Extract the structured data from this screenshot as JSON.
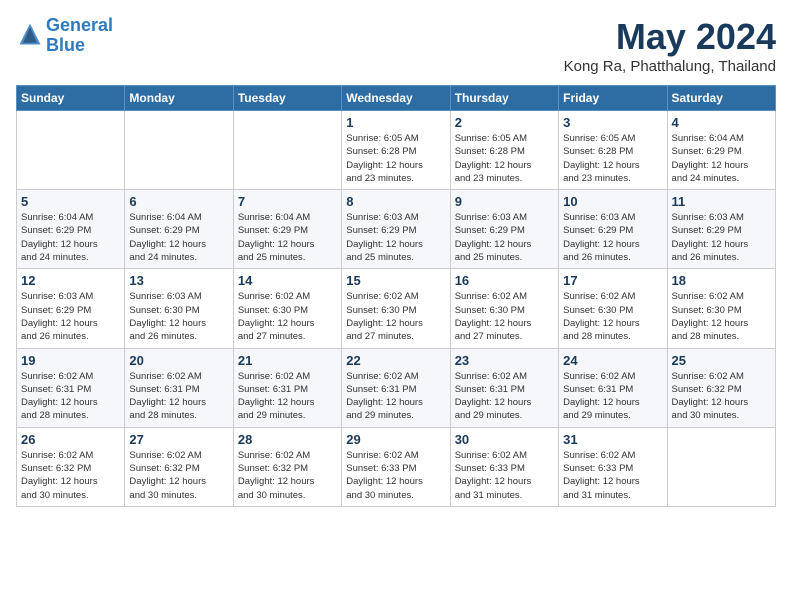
{
  "logo": {
    "line1": "General",
    "line2": "Blue"
  },
  "title": "May 2024",
  "location": "Kong Ra, Phatthalung, Thailand",
  "weekdays": [
    "Sunday",
    "Monday",
    "Tuesday",
    "Wednesday",
    "Thursday",
    "Friday",
    "Saturday"
  ],
  "weeks": [
    [
      {
        "day": "",
        "info": ""
      },
      {
        "day": "",
        "info": ""
      },
      {
        "day": "",
        "info": ""
      },
      {
        "day": "1",
        "info": "Sunrise: 6:05 AM\nSunset: 6:28 PM\nDaylight: 12 hours\nand 23 minutes."
      },
      {
        "day": "2",
        "info": "Sunrise: 6:05 AM\nSunset: 6:28 PM\nDaylight: 12 hours\nand 23 minutes."
      },
      {
        "day": "3",
        "info": "Sunrise: 6:05 AM\nSunset: 6:28 PM\nDaylight: 12 hours\nand 23 minutes."
      },
      {
        "day": "4",
        "info": "Sunrise: 6:04 AM\nSunset: 6:29 PM\nDaylight: 12 hours\nand 24 minutes."
      }
    ],
    [
      {
        "day": "5",
        "info": "Sunrise: 6:04 AM\nSunset: 6:29 PM\nDaylight: 12 hours\nand 24 minutes."
      },
      {
        "day": "6",
        "info": "Sunrise: 6:04 AM\nSunset: 6:29 PM\nDaylight: 12 hours\nand 24 minutes."
      },
      {
        "day": "7",
        "info": "Sunrise: 6:04 AM\nSunset: 6:29 PM\nDaylight: 12 hours\nand 25 minutes."
      },
      {
        "day": "8",
        "info": "Sunrise: 6:03 AM\nSunset: 6:29 PM\nDaylight: 12 hours\nand 25 minutes."
      },
      {
        "day": "9",
        "info": "Sunrise: 6:03 AM\nSunset: 6:29 PM\nDaylight: 12 hours\nand 25 minutes."
      },
      {
        "day": "10",
        "info": "Sunrise: 6:03 AM\nSunset: 6:29 PM\nDaylight: 12 hours\nand 26 minutes."
      },
      {
        "day": "11",
        "info": "Sunrise: 6:03 AM\nSunset: 6:29 PM\nDaylight: 12 hours\nand 26 minutes."
      }
    ],
    [
      {
        "day": "12",
        "info": "Sunrise: 6:03 AM\nSunset: 6:29 PM\nDaylight: 12 hours\nand 26 minutes."
      },
      {
        "day": "13",
        "info": "Sunrise: 6:03 AM\nSunset: 6:30 PM\nDaylight: 12 hours\nand 26 minutes."
      },
      {
        "day": "14",
        "info": "Sunrise: 6:02 AM\nSunset: 6:30 PM\nDaylight: 12 hours\nand 27 minutes."
      },
      {
        "day": "15",
        "info": "Sunrise: 6:02 AM\nSunset: 6:30 PM\nDaylight: 12 hours\nand 27 minutes."
      },
      {
        "day": "16",
        "info": "Sunrise: 6:02 AM\nSunset: 6:30 PM\nDaylight: 12 hours\nand 27 minutes."
      },
      {
        "day": "17",
        "info": "Sunrise: 6:02 AM\nSunset: 6:30 PM\nDaylight: 12 hours\nand 28 minutes."
      },
      {
        "day": "18",
        "info": "Sunrise: 6:02 AM\nSunset: 6:30 PM\nDaylight: 12 hours\nand 28 minutes."
      }
    ],
    [
      {
        "day": "19",
        "info": "Sunrise: 6:02 AM\nSunset: 6:31 PM\nDaylight: 12 hours\nand 28 minutes."
      },
      {
        "day": "20",
        "info": "Sunrise: 6:02 AM\nSunset: 6:31 PM\nDaylight: 12 hours\nand 28 minutes."
      },
      {
        "day": "21",
        "info": "Sunrise: 6:02 AM\nSunset: 6:31 PM\nDaylight: 12 hours\nand 29 minutes."
      },
      {
        "day": "22",
        "info": "Sunrise: 6:02 AM\nSunset: 6:31 PM\nDaylight: 12 hours\nand 29 minutes."
      },
      {
        "day": "23",
        "info": "Sunrise: 6:02 AM\nSunset: 6:31 PM\nDaylight: 12 hours\nand 29 minutes."
      },
      {
        "day": "24",
        "info": "Sunrise: 6:02 AM\nSunset: 6:31 PM\nDaylight: 12 hours\nand 29 minutes."
      },
      {
        "day": "25",
        "info": "Sunrise: 6:02 AM\nSunset: 6:32 PM\nDaylight: 12 hours\nand 30 minutes."
      }
    ],
    [
      {
        "day": "26",
        "info": "Sunrise: 6:02 AM\nSunset: 6:32 PM\nDaylight: 12 hours\nand 30 minutes."
      },
      {
        "day": "27",
        "info": "Sunrise: 6:02 AM\nSunset: 6:32 PM\nDaylight: 12 hours\nand 30 minutes."
      },
      {
        "day": "28",
        "info": "Sunrise: 6:02 AM\nSunset: 6:32 PM\nDaylight: 12 hours\nand 30 minutes."
      },
      {
        "day": "29",
        "info": "Sunrise: 6:02 AM\nSunset: 6:33 PM\nDaylight: 12 hours\nand 30 minutes."
      },
      {
        "day": "30",
        "info": "Sunrise: 6:02 AM\nSunset: 6:33 PM\nDaylight: 12 hours\nand 31 minutes."
      },
      {
        "day": "31",
        "info": "Sunrise: 6:02 AM\nSunset: 6:33 PM\nDaylight: 12 hours\nand 31 minutes."
      },
      {
        "day": "",
        "info": ""
      }
    ]
  ]
}
